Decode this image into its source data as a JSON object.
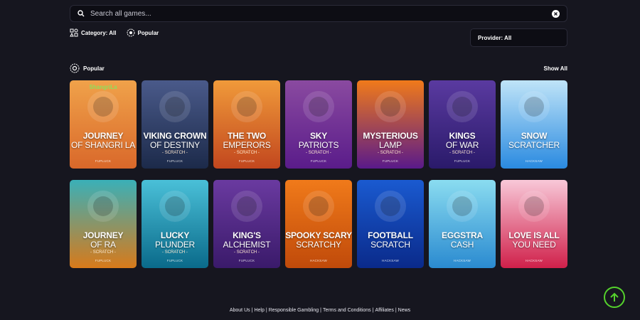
{
  "search": {
    "placeholder": "Search all games..."
  },
  "filters": {
    "category": "Category: All",
    "popular": "Popular"
  },
  "provider": {
    "label": "Provider: All"
  },
  "section": {
    "title": "Popular",
    "show_all": "Show All"
  },
  "games_row1": [
    {
      "title1": "JOURNEY",
      "title2": "OF SHANGRI LA",
      "subtitle": "",
      "provider": "FUPLUCK",
      "logo": "ShangriLa",
      "bg1": "#f0a24a",
      "bg2": "#d9682a"
    },
    {
      "title1": "VIKING CROWN",
      "title2": "OF DESTINY",
      "subtitle": "- SCRATCH -",
      "provider": "FUPLUCK",
      "bg1": "#4a5a8a",
      "bg2": "#1c2a4a"
    },
    {
      "title1": "THE TWO",
      "title2": "EMPERORS",
      "subtitle": "- SCRATCH -",
      "provider": "FUPLUCK",
      "bg1": "#f09a3a",
      "bg2": "#c2471e"
    },
    {
      "title1": "SKY",
      "title2": "PATRIOTS",
      "subtitle": "- SCRATCH -",
      "provider": "FUPLUCK",
      "bg1": "#8a4aa0",
      "bg2": "#5a1c8a"
    },
    {
      "title1": "MYSTERIOUS",
      "title2": "LAMP",
      "subtitle": "- SCRATCH -",
      "provider": "FUPLUCK",
      "bg1": "#f07a1a",
      "bg2": "#5a1a8a"
    },
    {
      "title1": "KINGS",
      "title2": "OF WAR",
      "subtitle": "- SCRATCH -",
      "provider": "FUPLUCK",
      "bg1": "#5a3aa0",
      "bg2": "#2a1a6a"
    },
    {
      "title1": "SNOW",
      "title2": "SCRATCHER",
      "subtitle": "",
      "provider": "HACKSAW",
      "bg1": "#bfe4f8",
      "bg2": "#2a8ae0"
    }
  ],
  "games_row2": [
    {
      "title1": "JOURNEY",
      "title2": "OF RA",
      "subtitle": "- SCRATCH -",
      "provider": "FUPLUCK",
      "bg1": "#3ab0b8",
      "bg2": "#d87a1a"
    },
    {
      "title1": "LUCKY",
      "title2": "PLUNDER",
      "subtitle": "- SCRATCH -",
      "provider": "FUPLUCK",
      "bg1": "#4ac0d8",
      "bg2": "#0a6a8a"
    },
    {
      "title1": "KING'S",
      "title2": "ALCHEMIST",
      "subtitle": "- SCRATCH -",
      "provider": "FUPLUCK",
      "bg1": "#6a3aa0",
      "bg2": "#3a1a6a"
    },
    {
      "title1": "SPOOKY SCARY",
      "title2": "SCRATCHY",
      "subtitle": "",
      "provider": "HACKSAW",
      "bg1": "#f07a1a",
      "bg2": "#c04a0a"
    },
    {
      "title1": "FOOTBALL",
      "title2": "SCRATCH",
      "subtitle": "",
      "provider": "HACKSAW",
      "bg1": "#1a5ad0",
      "bg2": "#0a2a8a"
    },
    {
      "title1": "EGGSTRA",
      "title2": "CASH",
      "subtitle": "",
      "provider": "HACKSAW",
      "bg1": "#8adcf0",
      "bg2": "#2a8ad0"
    },
    {
      "title1": "LOVE IS ALL",
      "title2": "YOU NEED",
      "subtitle": "",
      "provider": "HACKSAW",
      "bg1": "#f8c8d8",
      "bg2": "#d0204a"
    }
  ],
  "footer": {
    "about": "About Us",
    "help": "Help",
    "responsible": "Responsible Gambling",
    "terms": "Terms and Conditions",
    "affiliates": "Affiliates",
    "news": "News",
    "sep": "|"
  },
  "colors": {
    "background": "#16161f",
    "accent_green": "#55d22c"
  }
}
